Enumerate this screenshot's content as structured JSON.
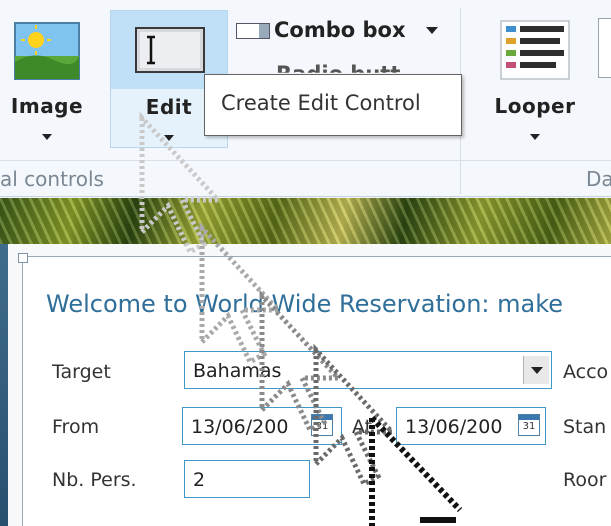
{
  "ribbon": {
    "image_label": "Image",
    "edit_label": "Edit",
    "looper_label": "Looper",
    "combo_label": "Combo box",
    "cut_off_item": "Radio butt",
    "group_left": "al controls",
    "group_right": "Da"
  },
  "tooltip": {
    "text": "Create Edit Control"
  },
  "form": {
    "title": "Welcome to World Wide Reservation: make",
    "target_label": "Target",
    "target_value": "Bahamas",
    "from_label": "From",
    "from_value": "13/06/200",
    "at_label": "At",
    "to_value": "13/06/200",
    "nbpers_label": "Nb. Pers.",
    "nbpers_value": "2",
    "right_label_1": "Acco",
    "right_label_2": "Stan",
    "right_label_3": "Roor",
    "calendar_day": "31"
  },
  "colors": {
    "accent": "#3f98c7",
    "title": "#2f6f9a",
    "ribbon_highlight": "#bfe0f7"
  }
}
